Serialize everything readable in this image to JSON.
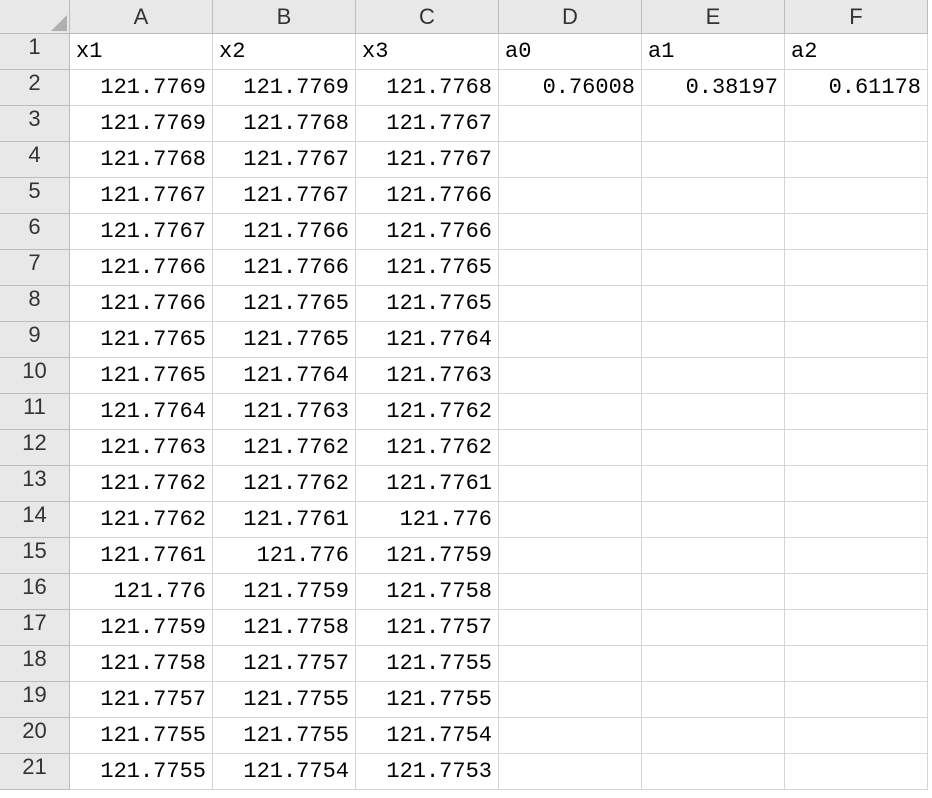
{
  "columns": [
    "A",
    "B",
    "C",
    "D",
    "E",
    "F"
  ],
  "row_numbers": [
    1,
    2,
    3,
    4,
    5,
    6,
    7,
    8,
    9,
    10,
    11,
    12,
    13,
    14,
    15,
    16,
    17,
    18,
    19,
    20,
    21
  ],
  "headers": {
    "A": "x1",
    "B": "x2",
    "C": "x3",
    "D": "a0",
    "E": "a1",
    "F": "a2"
  },
  "chart_data": {
    "type": "table",
    "columns": [
      "x1",
      "x2",
      "x3",
      "a0",
      "a1",
      "a2"
    ],
    "rows": [
      {
        "x1": "121.7769",
        "x2": "121.7769",
        "x3": "121.7768",
        "a0": "0.76008",
        "a1": "0.38197",
        "a2": "0.61178"
      },
      {
        "x1": "121.7769",
        "x2": "121.7768",
        "x3": "121.7767"
      },
      {
        "x1": "121.7768",
        "x2": "121.7767",
        "x3": "121.7767"
      },
      {
        "x1": "121.7767",
        "x2": "121.7767",
        "x3": "121.7766"
      },
      {
        "x1": "121.7767",
        "x2": "121.7766",
        "x3": "121.7766"
      },
      {
        "x1": "121.7766",
        "x2": "121.7766",
        "x3": "121.7765"
      },
      {
        "x1": "121.7766",
        "x2": "121.7765",
        "x3": "121.7765"
      },
      {
        "x1": "121.7765",
        "x2": "121.7765",
        "x3": "121.7764"
      },
      {
        "x1": "121.7765",
        "x2": "121.7764",
        "x3": "121.7763"
      },
      {
        "x1": "121.7764",
        "x2": "121.7763",
        "x3": "121.7762"
      },
      {
        "x1": "121.7763",
        "x2": "121.7762",
        "x3": "121.7762"
      },
      {
        "x1": "121.7762",
        "x2": "121.7762",
        "x3": "121.7761"
      },
      {
        "x1": "121.7762",
        "x2": "121.7761",
        "x3": "121.776"
      },
      {
        "x1": "121.7761",
        "x2": "121.776",
        "x3": "121.7759"
      },
      {
        "x1": "121.776",
        "x2": "121.7759",
        "x3": "121.7758"
      },
      {
        "x1": "121.7759",
        "x2": "121.7758",
        "x3": "121.7757"
      },
      {
        "x1": "121.7758",
        "x2": "121.7757",
        "x3": "121.7755"
      },
      {
        "x1": "121.7757",
        "x2": "121.7755",
        "x3": "121.7755"
      },
      {
        "x1": "121.7755",
        "x2": "121.7755",
        "x3": "121.7754"
      },
      {
        "x1": "121.7755",
        "x2": "121.7754",
        "x3": "121.7753"
      }
    ]
  }
}
